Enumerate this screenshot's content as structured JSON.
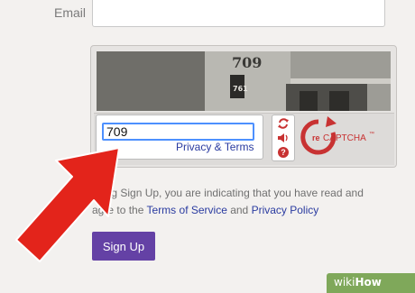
{
  "form": {
    "email_label": "Email",
    "email_value": ""
  },
  "captcha": {
    "image_text": "709",
    "image_plate": "761",
    "answer_value": "709",
    "privacy_link": "Privacy & Terms",
    "logo_prefix": "re",
    "logo_word": "CAPTCHA",
    "logo_tm": "™",
    "reload_icon": "reload-icon",
    "audio_icon": "audio-icon",
    "help_icon": "help-icon",
    "help_glyph": "?"
  },
  "disclaimer": {
    "line1_start": "cking Sign Up, you are indicating that you have read and",
    "line2_start": "agre",
    "line2_mid": " to the ",
    "terms_link": "Terms of Service",
    "and_text": " and ",
    "privacy_link": "Privacy Policy"
  },
  "signup": {
    "label": "Sign Up"
  },
  "watermark": {
    "wiki": "wiki",
    "how": "How"
  },
  "colors": {
    "accent": "#6441a5",
    "link": "#2a3ba0",
    "arrow": "#e3241b",
    "captcha_red": "#c83232"
  }
}
